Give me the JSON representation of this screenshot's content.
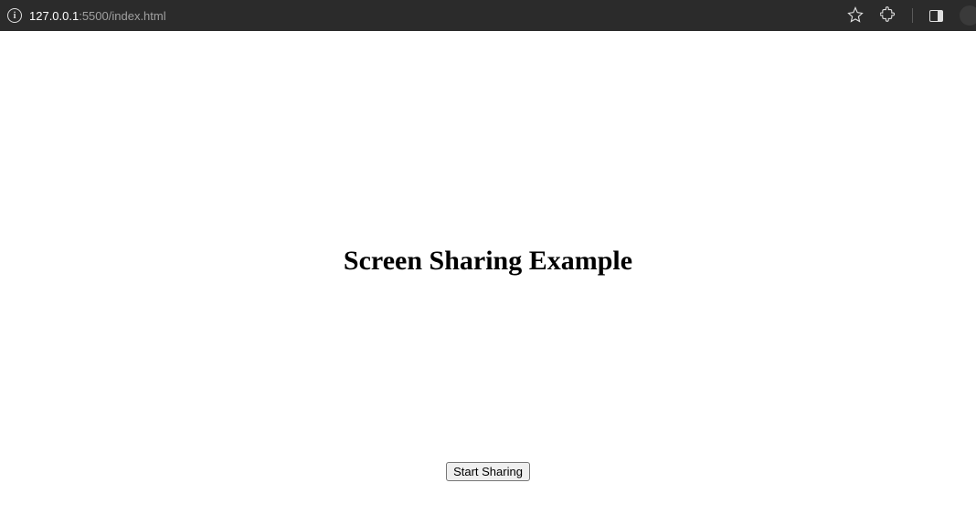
{
  "browser": {
    "url_host": "127.0.0.1",
    "url_port_path": ":5500/index.html"
  },
  "page": {
    "title": "Screen Sharing Example",
    "start_button_label": "Start Sharing"
  }
}
